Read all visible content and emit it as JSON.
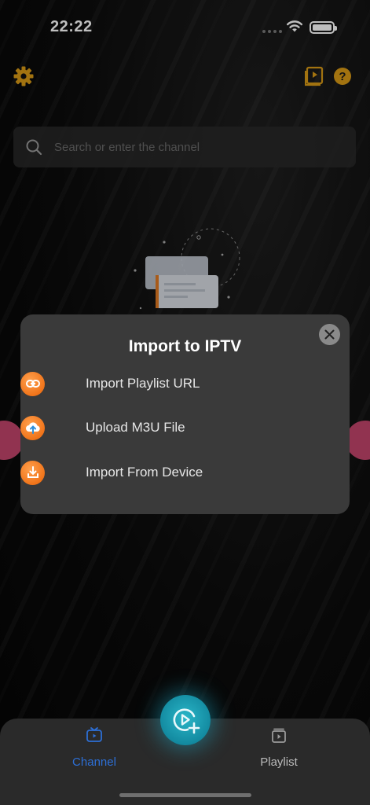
{
  "status_bar": {
    "time": "22:22"
  },
  "search": {
    "placeholder": "Search or enter the channel"
  },
  "modal": {
    "title": "Import to IPTV",
    "options": [
      {
        "label": "Import Playlist URL",
        "icon": "link-icon"
      },
      {
        "label": "Upload M3U File",
        "icon": "cloud-upload-icon"
      },
      {
        "label": "Import From Device",
        "icon": "download-icon"
      }
    ]
  },
  "tabs": [
    {
      "label": "Channel",
      "icon": "tv-icon",
      "active": true
    },
    {
      "label": "Playlist",
      "icon": "playlist-icon",
      "active": false
    }
  ],
  "colors": {
    "accent_orange": "#f0741a",
    "accent_gold": "#d89a16",
    "active_tab": "#2d6fd6",
    "fab": "#138aa0",
    "modal_bg": "#3a3a3a"
  }
}
